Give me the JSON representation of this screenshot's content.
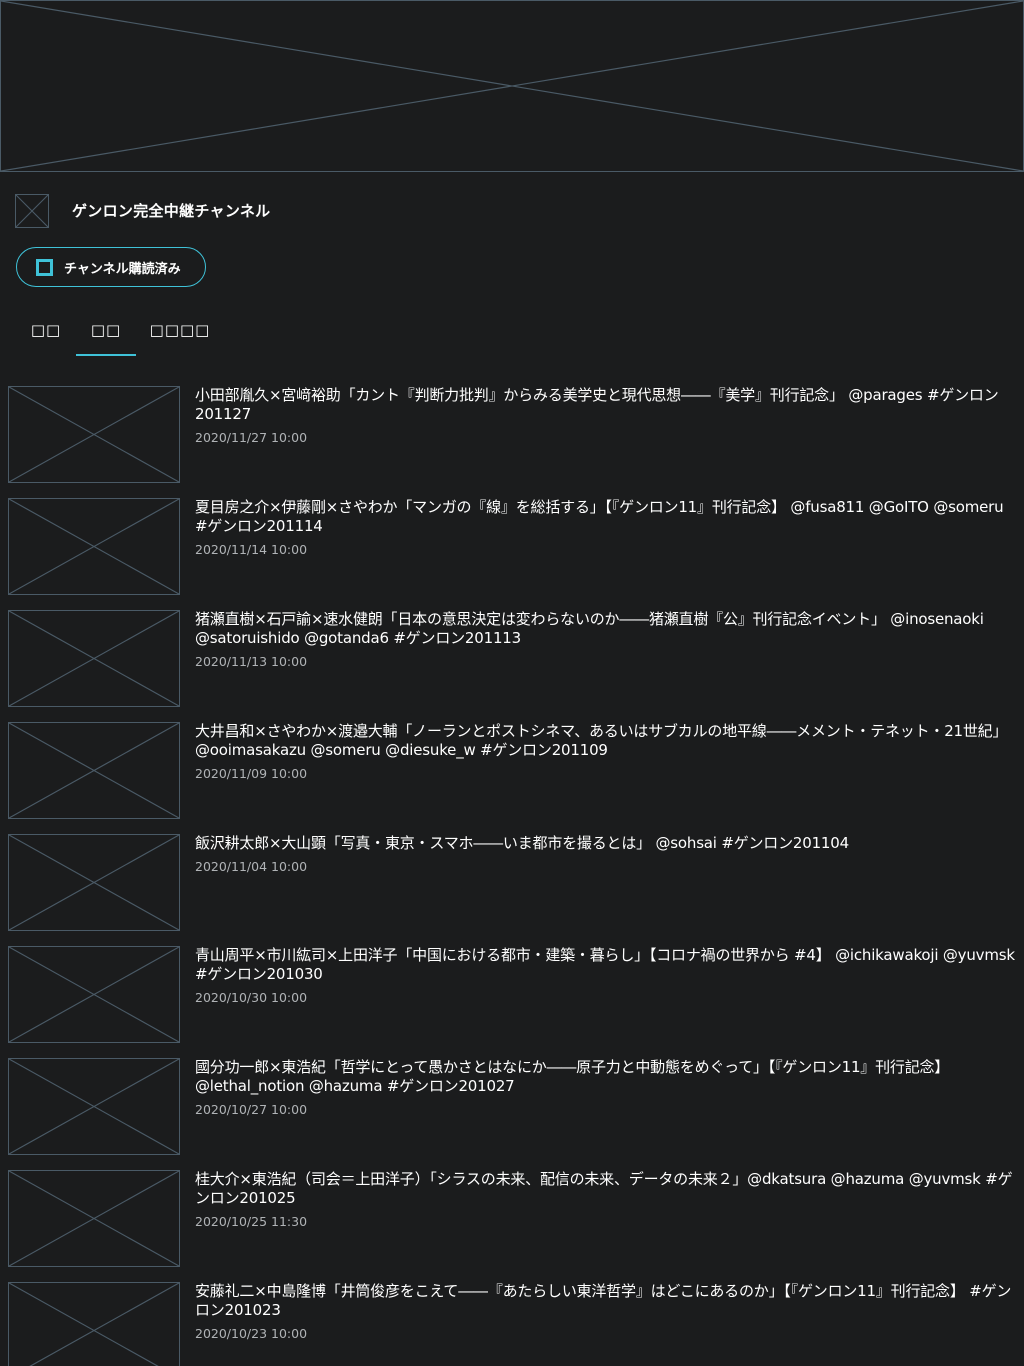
{
  "banner": {
    "icon": "image-placeholder-icon"
  },
  "channel": {
    "icon": "image-placeholder-icon",
    "name": "ゲンロン完全中継チャンネル",
    "subscribe_label": "チャンネル購読済み",
    "subscribed": true,
    "accent_color": "#3fc2d8"
  },
  "tabs": [
    {
      "label": "□□",
      "active": false
    },
    {
      "label": "□□",
      "active": true
    },
    {
      "label": "□□□□",
      "active": false
    }
  ],
  "videos": [
    {
      "title": "小田部胤久×宮﨑裕助「カント『判断力批判』からみる美学史と現代思想――『美学』刊行記念」 @parages #ゲンロン201127",
      "date": "2020/11/27 10:00",
      "lines": 2
    },
    {
      "title": "夏目房之介×伊藤剛×さやわか「マンガの『線』を総括する」【『ゲンロン11』刊行記念】 @fusa811 @GoITO @someru #ゲンロン201114",
      "date": "2020/11/14 10:00",
      "lines": 2
    },
    {
      "title": "猪瀬直樹×石戸諭×速水健朗「日本の意思決定は変わらないのか――猪瀬直樹『公』刊行記念イベント」 @inosenaoki @satoruishido @gotanda6 #ゲンロン201113",
      "date": "2020/11/13 10:00",
      "lines": 2
    },
    {
      "title": "大井昌和×さやわか×渡邉大輔「ノーランとポストシネマ、あるいはサブカルの地平線――メメント・テネット・21世紀」 @ooimasakazu @someru @diesuke_w #ゲンロン201109",
      "date": "2020/11/09 10:00",
      "lines": 2
    },
    {
      "title": "飯沢耕太郎×大山顕「写真・東京・スマホ――いま都市を撮るとは」 @sohsai #ゲンロン201104",
      "date": "2020/11/04 10:00",
      "lines": 1
    },
    {
      "title": "青山周平×市川紘司×上田洋子「中国における都市・建築・暮らし」【コロナ禍の世界から #4】 @ichikawakoji @yuvmsk #ゲンロン201030",
      "date": "2020/10/30 10:00",
      "lines": 2
    },
    {
      "title": "國分功一郎×東浩紀「哲学にとって愚かさとはなにか――原子力と中動態をめぐって」【『ゲンロン11』刊行記念】 @lethal_notion @hazuma #ゲンロン201027",
      "date": "2020/10/27 10:00",
      "lines": 2
    },
    {
      "title": "桂大介×東浩紀（司会＝上田洋子）「シラスの未来、配信の未来、データの未来２」@dkatsura @hazuma @yuvmsk #ゲンロン201025",
      "date": "2020/10/25 11:30",
      "lines": 2
    },
    {
      "title": "安藤礼二×中島隆博「井筒俊彦をこえて――『あたらしい東洋哲学』はどこにあるのか」【『ゲンロン11』刊行記念】 #ゲンロン201023",
      "date": "2020/10/23 10:00",
      "lines": 2
    }
  ]
}
